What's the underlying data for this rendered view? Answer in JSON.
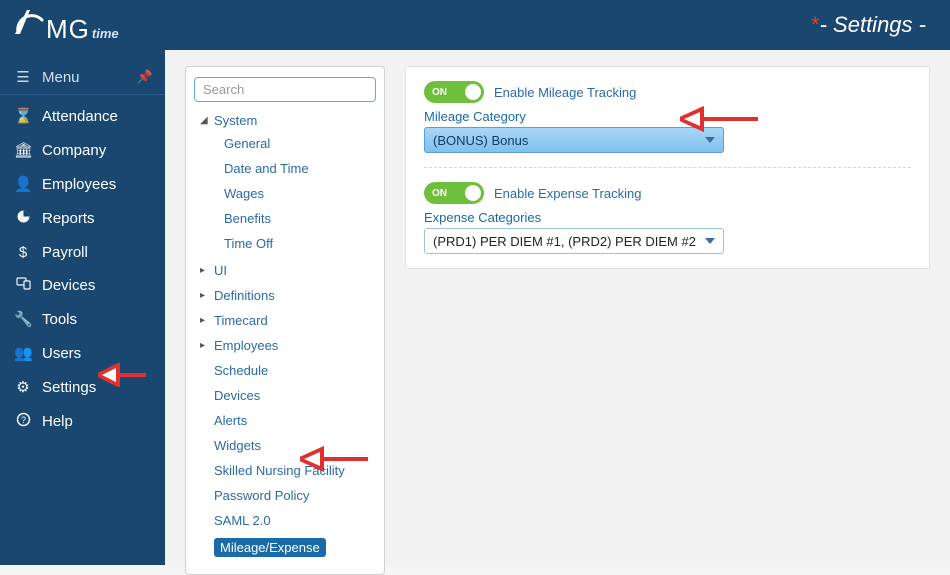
{
  "header": {
    "logo_text": "MG",
    "logo_sub": "time",
    "title": "Settings"
  },
  "nav": {
    "menu_label": "Menu",
    "items": [
      {
        "label": "Attendance",
        "icon": "hourglass-icon"
      },
      {
        "label": "Company",
        "icon": "bank-icon"
      },
      {
        "label": "Employees",
        "icon": "user-icon"
      },
      {
        "label": "Reports",
        "icon": "pie-icon"
      },
      {
        "label": "Payroll",
        "icon": "dollar-icon"
      },
      {
        "label": "Devices",
        "icon": "devices-icon"
      },
      {
        "label": "Tools",
        "icon": "wrench-icon"
      },
      {
        "label": "Users",
        "icon": "users-icon"
      },
      {
        "label": "Settings",
        "icon": "gear-icon"
      },
      {
        "label": "Help",
        "icon": "question-icon"
      }
    ]
  },
  "tree": {
    "search_placeholder": "Search",
    "root": "System",
    "system_children": [
      "General",
      "Date and Time",
      "Wages",
      "Benefits",
      "Time Off"
    ],
    "collapsed_nodes": [
      "UI",
      "Definitions",
      "Timecard",
      "Employees"
    ],
    "leaf_nodes": [
      "Schedule",
      "Devices",
      "Alerts",
      "Widgets",
      "Skilled Nursing Facility",
      "Password Policy",
      "SAML 2.0"
    ],
    "selected_leaf": "Mileage/Expense"
  },
  "main": {
    "toggle_on": "ON",
    "mileage_toggle_label": "Enable Mileage Tracking",
    "mileage_category_label": "Mileage Category",
    "mileage_category_value": "(BONUS) Bonus",
    "expense_toggle_label": "Enable Expense Tracking",
    "expense_categories_label": "Expense Categories",
    "expense_categories_value": "(PRD1) PER DIEM #1, (PRD2) PER DIEM #2"
  },
  "colors": {
    "brand_bg": "#1a4770",
    "link": "#2a6aa8",
    "toggle_on": "#6ebf3b",
    "arrow": "#e03030"
  }
}
